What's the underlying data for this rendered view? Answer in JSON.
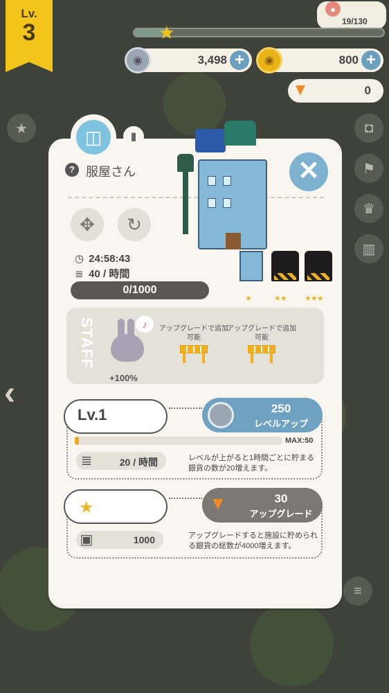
{
  "player": {
    "level_label": "Lv.",
    "level": "3"
  },
  "xp": {
    "text": "19/130",
    "progress": 0.146
  },
  "currency": {
    "silver": "3,498",
    "gold": "800",
    "carrot": "0"
  },
  "shop": {
    "name": "服屋さん"
  },
  "timers": {
    "time": "24:58:43",
    "rate": "40 / 時間"
  },
  "capacity": "0/1000",
  "tiers": [
    {
      "stars": "★"
    },
    {
      "stars": "★★"
    },
    {
      "stars": "★★★"
    }
  ],
  "staff": {
    "title": "STAFF",
    "bonus": "+100%",
    "slot_text_1": "アップグレードで追加可能",
    "slot_text_2": "アップグレードで追加可能"
  },
  "level_section": {
    "level": "Lv.1",
    "cost": "250",
    "button_label": "レベルアップ",
    "max": "MAX:50",
    "progress": 0.02,
    "stat": "20 / 時間",
    "desc": "レベルが上がると1時間ごとに貯まる銀貨の数が20増えます。"
  },
  "upgrade_section": {
    "cost": "30",
    "button_label": "アップグレード",
    "stat": "1000",
    "desc": "アップグレードすると施設に貯められる銀貨の総数が4000増えます。"
  },
  "icons": [
    "star-icon",
    "camera-icon",
    "flag-icon",
    "trophy-icon",
    "ranking-icon",
    "menu-icon",
    "shop-bag-icon",
    "trash-icon",
    "close-icon",
    "move-icon",
    "rotate-icon",
    "clock-icon",
    "coins-icon",
    "safe-icon",
    "carrot-icon"
  ],
  "colors": {
    "accent": "#6ea2c0",
    "gold": "#f3c51c",
    "upgrade": "#7a7774"
  }
}
